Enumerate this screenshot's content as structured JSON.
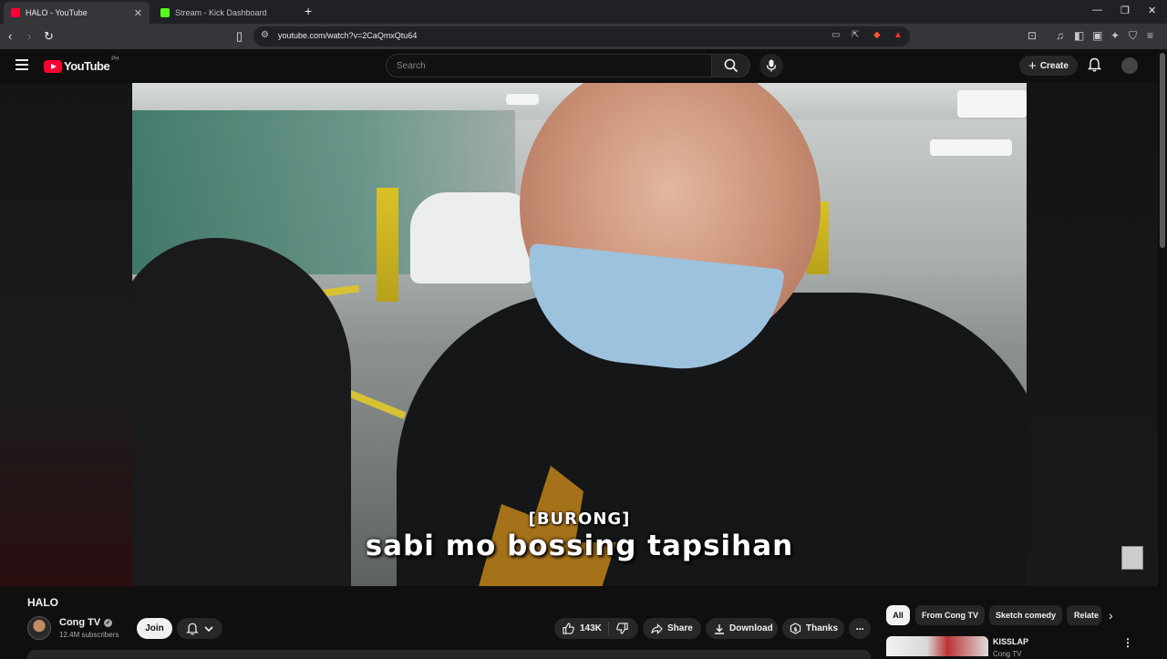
{
  "browser": {
    "tabs": [
      {
        "title": "HALO - YouTube",
        "favicon_color": "#ff0033",
        "active": true
      },
      {
        "title": "Stream - Kick Dashboard",
        "favicon_color": "#53fc18",
        "active": false
      }
    ],
    "url": "youtube.com/watch?v=2CaQmxQtu64"
  },
  "header": {
    "logo_text": "YouTube",
    "country_code": "PH",
    "search_placeholder": "Search",
    "create_label": "Create"
  },
  "video": {
    "subtitle_speaker": "[BURONG]",
    "subtitle_line": "sabi mo bossing tapsihan",
    "title": "HALO"
  },
  "channel": {
    "name": "Cong TV",
    "subscribers": "12.4M subscribers",
    "join_label": "Join"
  },
  "actions": {
    "likes": "143K",
    "share": "Share",
    "download": "Download",
    "thanks": "Thanks"
  },
  "chips": [
    "All",
    "From Cong TV",
    "Sketch comedy",
    "Relate"
  ],
  "recommendation": {
    "title": "KISSLAP",
    "channel": "Cong TV"
  },
  "colors": {
    "youtube_red": "#ff0033",
    "background": "#0f0f0f",
    "pill": "#272727"
  }
}
